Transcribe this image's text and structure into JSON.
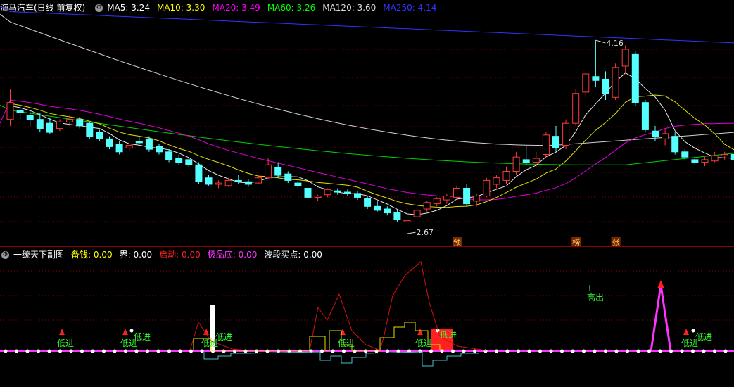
{
  "main_panel": {
    "title": "海马汽车(日线 前复权)",
    "indicators": [
      {
        "label": "MA5:",
        "value": "3.24",
        "color": "#ffffff"
      },
      {
        "label": "MA10:",
        "value": "3.30",
        "color": "#ffff00"
      },
      {
        "label": "MA20:",
        "value": "3.49",
        "color": "#ff00ff"
      },
      {
        "label": "MA60:",
        "value": "3.26",
        "color": "#00ff00"
      },
      {
        "label": "MA120:",
        "value": "3.60",
        "color": "#dddddd"
      },
      {
        "label": "MA250:",
        "value": "4.14",
        "color": "#3333ff"
      }
    ],
    "high_label": "4.16",
    "low_label": "2.67",
    "markers": [
      {
        "text": "预"
      },
      {
        "text": "榜"
      },
      {
        "text": "张"
      }
    ]
  },
  "sub_panel": {
    "title": "一统天下副图",
    "indicators": [
      {
        "label": "备钱:",
        "value": "0.00",
        "color": "#ffff00"
      },
      {
        "label": "界:",
        "value": "0.00",
        "color": "#ffffff"
      },
      {
        "label": "启动:",
        "value": "0.00",
        "color": "#ff2020"
      },
      {
        "label": "极品底:",
        "value": "0.00",
        "color": "#ff33ff"
      },
      {
        "label": "波段买点:",
        "value": "0.00",
        "color": "#ffffff"
      }
    ],
    "signal_label_low": "低进",
    "signal_label_high": "高出"
  },
  "chart_data": {
    "type": "candlestick",
    "candles": [
      [
        3.55,
        3.78,
        3.5,
        3.68
      ],
      [
        3.62,
        3.66,
        3.55,
        3.6
      ],
      [
        3.58,
        3.62,
        3.5,
        3.55
      ],
      [
        3.55,
        3.6,
        3.45,
        3.48
      ],
      [
        3.52,
        3.56,
        3.44,
        3.45
      ],
      [
        3.48,
        3.55,
        3.46,
        3.53
      ],
      [
        3.53,
        3.58,
        3.5,
        3.55
      ],
      [
        3.55,
        3.57,
        3.48,
        3.5
      ],
      [
        3.52,
        3.53,
        3.4,
        3.42
      ],
      [
        3.45,
        3.47,
        3.38,
        3.4
      ],
      [
        3.4,
        3.42,
        3.32,
        3.34
      ],
      [
        3.36,
        3.38,
        3.28,
        3.3
      ],
      [
        3.33,
        3.36,
        3.3,
        3.35
      ],
      [
        3.38,
        3.42,
        3.36,
        3.37
      ],
      [
        3.4,
        3.42,
        3.3,
        3.32
      ],
      [
        3.34,
        3.36,
        3.28,
        3.3
      ],
      [
        3.3,
        3.32,
        3.22,
        3.24
      ],
      [
        3.25,
        3.28,
        3.2,
        3.22
      ],
      [
        3.24,
        3.26,
        3.18,
        3.2
      ],
      [
        3.2,
        3.22,
        3.05,
        3.07
      ],
      [
        3.1,
        3.12,
        3.04,
        3.05
      ],
      [
        3.05,
        3.08,
        3.02,
        3.06
      ],
      [
        3.04,
        3.1,
        3.03,
        3.08
      ],
      [
        3.08,
        3.12,
        3.05,
        3.07
      ],
      [
        3.07,
        3.09,
        3.03,
        3.05
      ],
      [
        3.06,
        3.12,
        3.05,
        3.1
      ],
      [
        3.1,
        3.25,
        3.09,
        3.2
      ],
      [
        3.18,
        3.22,
        3.1,
        3.12
      ],
      [
        3.13,
        3.15,
        3.06,
        3.08
      ],
      [
        3.06,
        3.08,
        3.02,
        3.04
      ],
      [
        3.02,
        3.04,
        2.93,
        2.95
      ],
      [
        2.95,
        2.97,
        2.92,
        2.96
      ],
      [
        2.97,
        3.02,
        2.95,
        3.01
      ],
      [
        3.0,
        3.02,
        2.97,
        2.99
      ],
      [
        2.99,
        3.01,
        2.96,
        2.98
      ],
      [
        2.98,
        3.0,
        2.93,
        2.95
      ],
      [
        2.94,
        2.96,
        2.86,
        2.88
      ],
      [
        2.88,
        2.92,
        2.84,
        2.85
      ],
      [
        2.86,
        2.88,
        2.81,
        2.83
      ],
      [
        2.83,
        2.85,
        2.76,
        2.78
      ],
      [
        2.76,
        2.8,
        2.67,
        2.77
      ],
      [
        2.8,
        2.86,
        2.79,
        2.85
      ],
      [
        2.86,
        2.92,
        2.84,
        2.91
      ],
      [
        2.9,
        2.95,
        2.88,
        2.94
      ],
      [
        2.93,
        2.98,
        2.9,
        2.96
      ],
      [
        2.95,
        3.04,
        2.93,
        3.02
      ],
      [
        3.02,
        3.05,
        2.88,
        2.9
      ],
      [
        2.92,
        2.98,
        2.88,
        2.96
      ],
      [
        2.96,
        3.1,
        2.95,
        3.08
      ],
      [
        3.05,
        3.12,
        3.02,
        3.1
      ],
      [
        3.08,
        3.18,
        3.05,
        3.15
      ],
      [
        3.15,
        3.3,
        3.12,
        3.26
      ],
      [
        3.24,
        3.35,
        3.2,
        3.22
      ],
      [
        3.22,
        3.3,
        3.18,
        3.25
      ],
      [
        3.28,
        3.45,
        3.25,
        3.43
      ],
      [
        3.42,
        3.5,
        3.3,
        3.33
      ],
      [
        3.35,
        3.55,
        3.32,
        3.52
      ],
      [
        3.52,
        3.78,
        3.5,
        3.75
      ],
      [
        3.76,
        3.92,
        3.72,
        3.9
      ],
      [
        3.88,
        4.16,
        3.8,
        3.85
      ],
      [
        3.86,
        3.92,
        3.7,
        3.75
      ],
      [
        3.72,
        3.98,
        3.7,
        3.95
      ],
      [
        3.96,
        4.12,
        3.9,
        4.09
      ],
      [
        4.05,
        4.08,
        3.65,
        3.68
      ],
      [
        3.68,
        3.7,
        3.45,
        3.47
      ],
      [
        3.46,
        3.5,
        3.38,
        3.42
      ],
      [
        3.4,
        3.48,
        3.35,
        3.44
      ],
      [
        3.42,
        3.45,
        3.28,
        3.3
      ],
      [
        3.3,
        3.32,
        3.24,
        3.26
      ],
      [
        3.24,
        3.27,
        3.2,
        3.22
      ],
      [
        3.22,
        3.26,
        3.19,
        3.24
      ],
      [
        3.23,
        3.3,
        3.22,
        3.27
      ],
      [
        3.27,
        3.3,
        3.24,
        3.28
      ],
      [
        3.28,
        3.33,
        3.22,
        3.24
      ]
    ],
    "ma_series_order": [
      "MA5",
      "MA10",
      "MA20",
      "MA60",
      "MA120",
      "MA250"
    ],
    "price_range": [
      2.6,
      4.35
    ]
  }
}
